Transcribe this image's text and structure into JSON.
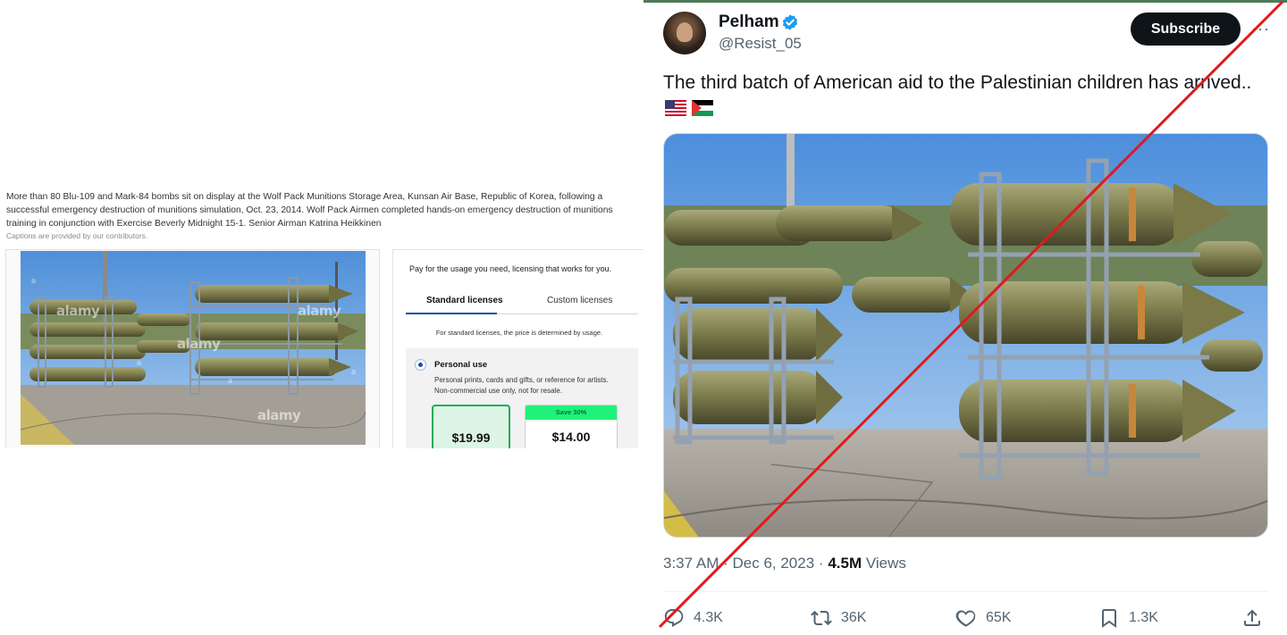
{
  "stock_listing": {
    "caption": "More than 80 Blu-109 and Mark-84 bombs sit on display at the Wolf Pack Munitions Storage Area, Kunsan Air Base, Republic of Korea, following a successful emergency destruction of munitions simulation, Oct. 23, 2014. Wolf Pack Airmen completed hands-on emergency destruction of munitions training in conjunction with Exercise Beverly Midnight 15-1. Senior Airman Katrina Heikkinen",
    "caption_note": "Captions are provided by our contributors.",
    "watermark": "alamy",
    "watermark_small": "a",
    "license": {
      "intro": "Pay for the usage you need, licensing that works for you.",
      "tabs": [
        {
          "label": "Standard licenses",
          "active": true
        },
        {
          "label": "Custom licenses",
          "active": false
        }
      ],
      "price_note": "For standard licenses, the price is determined by usage.",
      "option": {
        "title": "Personal use",
        "description": "Personal prints, cards and gifts, or reference for artists. Non-commercial use only, not for resale.",
        "price_single": "$19.99",
        "save_badge": "Save 30%",
        "price_discount": "$14.00"
      }
    }
  },
  "tweet": {
    "display_name": "Pelham",
    "handle": "@Resist_05",
    "subscribe_label": "Subscribe",
    "more_label": "···",
    "text": "The third batch of American aid to the Palestinian children has arrived..",
    "flag_icons": [
      "us-flag-icon",
      "palestine-flag-icon"
    ],
    "time": "3:37 AM",
    "date": "Dec 6, 2023",
    "views_count": "4.5M",
    "views_label": "Views",
    "actions": {
      "replies": "4.3K",
      "reposts": "36K",
      "likes": "65K",
      "bookmarks": "1.3K"
    },
    "overlay_strike_color": "#e0191e"
  },
  "colors": {
    "accent_blue": "#1d9bf0",
    "subscribe_bg": "#0f1419",
    "muted_text": "#536471",
    "green_save": "#1ff27a",
    "tab_active": "#1c4fa3"
  }
}
